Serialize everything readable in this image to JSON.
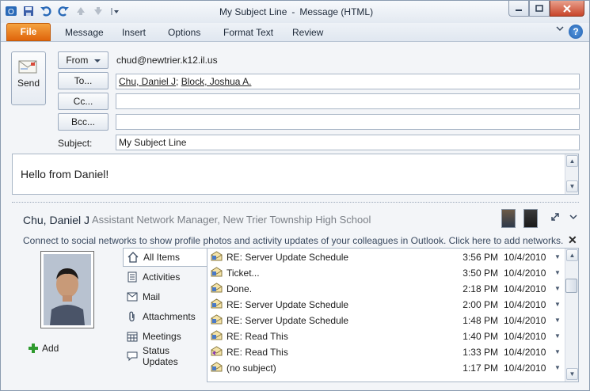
{
  "window": {
    "title_subject": "My Subject Line",
    "title_sep": "-",
    "title_app": "Message (HTML)"
  },
  "ribbon": {
    "tabs": [
      "File",
      "Message",
      "Insert",
      "Options",
      "Format Text",
      "Review"
    ],
    "help_label": "?"
  },
  "compose": {
    "send_label": "Send",
    "from_label": "From",
    "from_address": "chud@newtrier.k12.il.us",
    "to_label": "To...",
    "to_recipients": [
      "Chu, Daniel J",
      "Block, Joshua A."
    ],
    "cc_label": "Cc...",
    "bcc_label": "Bcc...",
    "subject_label": "Subject:",
    "subject_value": "My Subject Line",
    "body_text": "Hello from Daniel!"
  },
  "people_pane": {
    "name": "Chu, Daniel J",
    "title": "Assistant Network Manager, New Trier Township High School",
    "social_notice": "Connect to social networks to show profile photos and activity updates of your colleagues in Outlook. Click here to add networks.",
    "add_label": "Add",
    "nav": [
      "All Items",
      "Activities",
      "Mail",
      "Attachments",
      "Meetings",
      "Status Updates"
    ],
    "items": [
      {
        "subject": "RE: Server Update Schedule",
        "time": "3:56 PM",
        "date": "10/4/2010"
      },
      {
        "subject": "Ticket...",
        "time": "3:50 PM",
        "date": "10/4/2010"
      },
      {
        "subject": "Done.",
        "time": "2:18 PM",
        "date": "10/4/2010"
      },
      {
        "subject": "RE: Server Update Schedule",
        "time": "2:00 PM",
        "date": "10/4/2010"
      },
      {
        "subject": "RE: Server Update Schedule",
        "time": "1:48 PM",
        "date": "10/4/2010"
      },
      {
        "subject": "RE: Read This",
        "time": "1:40 PM",
        "date": "10/4/2010"
      },
      {
        "subject": "RE: Read This",
        "time": "1:33 PM",
        "date": "10/4/2010"
      },
      {
        "subject": "(no subject)",
        "time": "1:17 PM",
        "date": "10/4/2010"
      }
    ]
  },
  "colors": {
    "file_tab": "#e0640b",
    "close_button": "#c8452a",
    "add_plus": "#2e9a2e"
  }
}
